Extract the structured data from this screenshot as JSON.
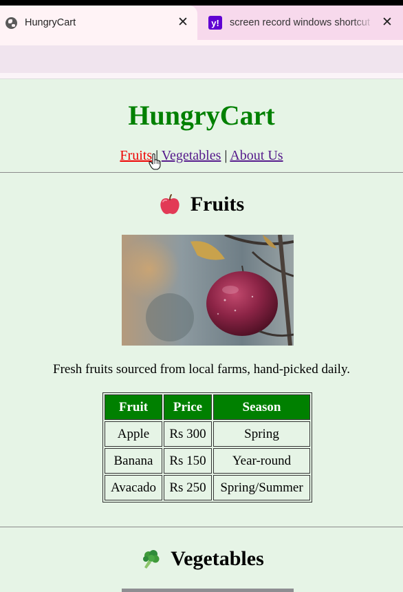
{
  "browser": {
    "tabs": [
      {
        "title": "HungryCart",
        "active": true,
        "icon": "globe-icon"
      },
      {
        "title": "screen record windows shortcut",
        "active": false,
        "icon": "yahoo-icon",
        "icon_letter": "y!"
      }
    ],
    "close_glyph": "✕"
  },
  "site": {
    "title": "HungryCart",
    "brand_color": "#008000",
    "nav": [
      {
        "label": "Fruits",
        "state": "active"
      },
      {
        "label": "Vegetables",
        "state": "visited"
      },
      {
        "label": "About Us",
        "state": "visited"
      }
    ],
    "nav_separator": "|"
  },
  "fruits": {
    "heading": "Fruits",
    "emoji": "apple-icon",
    "description": "Fresh fruits sourced from local farms, hand-picked daily.",
    "table": {
      "headers": [
        "Fruit",
        "Price",
        "Season"
      ],
      "rows": [
        [
          "Apple",
          "Rs 300",
          "Spring"
        ],
        [
          "Banana",
          "Rs 150",
          "Year-round"
        ],
        [
          "Avacado",
          "Rs 250",
          "Spring/Summer"
        ]
      ]
    }
  },
  "vegetables": {
    "heading": "Vegetables",
    "emoji": "broccoli-icon"
  }
}
